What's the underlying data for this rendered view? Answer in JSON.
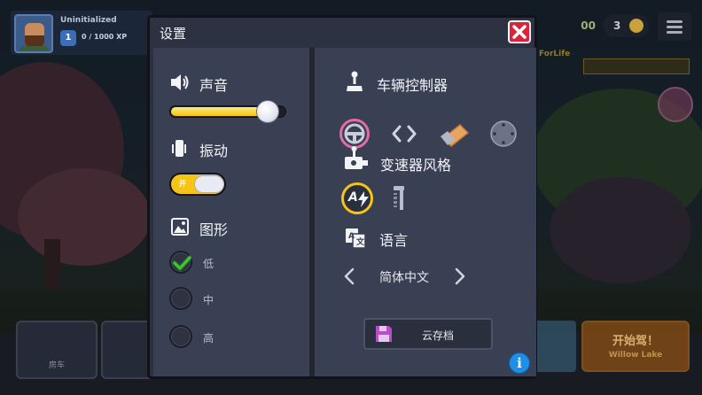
{
  "hud": {
    "player_name": "Uninitialized",
    "level": "1",
    "xp": "0 / 1000 XP",
    "money": "00",
    "coins": "3",
    "route_logo": "ForLife"
  },
  "background_tiles": {
    "left_label": "房车",
    "start_title": "开始驾！",
    "start_subtitle": "Willow Lake"
  },
  "dialog": {
    "title": "设置",
    "sound": {
      "label": "声音",
      "volume_level": 0.85
    },
    "vibration": {
      "label": "振动",
      "toggle_text": "开",
      "enabled": true
    },
    "graphics": {
      "label": "图形",
      "options": [
        {
          "label": "低",
          "selected": true
        },
        {
          "label": "中",
          "selected": false
        },
        {
          "label": "高",
          "selected": false
        }
      ]
    },
    "vehicle_control": {
      "label": "车辆控制器",
      "options": [
        "steering-wheel",
        "arrows",
        "tilt",
        "joystick"
      ],
      "selected": "steering-wheel"
    },
    "transmission": {
      "label": "变速器风格",
      "options": [
        "automatic",
        "manual"
      ],
      "selected": "automatic",
      "automatic_glyph": "A"
    },
    "language": {
      "label": "语言",
      "value": "简体中文"
    },
    "cloud_save_label": "云存档",
    "info_glyph": "i"
  },
  "colors": {
    "accent_yellow": "#f4c417",
    "close_red": "#d9243b",
    "selected_pink": "#e46aa9",
    "check_green": "#3ec934",
    "info_blue": "#1f8fe6"
  }
}
